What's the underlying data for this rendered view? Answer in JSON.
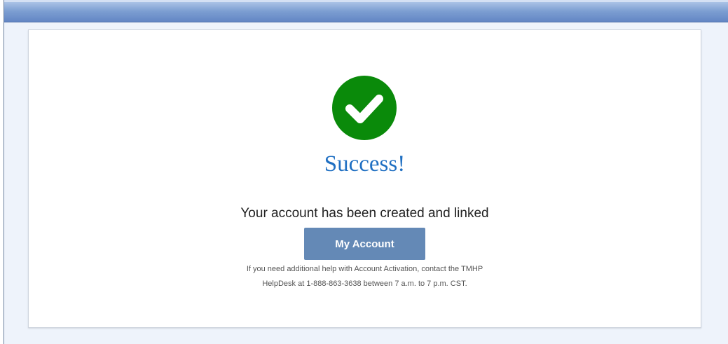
{
  "colors": {
    "success_green": "#0a8a0a",
    "title_blue": "#1f6fc2",
    "button_blue": "#6489b6",
    "header_bar_blue": "#7d9fd2"
  },
  "icons": {
    "status": "check-circle-icon"
  },
  "success": {
    "title": "Success!",
    "message": "Your account has been created and linked",
    "button_label": "My Account",
    "help_line_1": "If you need additional help with Account Activation, contact the TMHP",
    "help_line_2": "HelpDesk at 1-888-863-3638 between 7 a.m. to 7 p.m. CST."
  }
}
